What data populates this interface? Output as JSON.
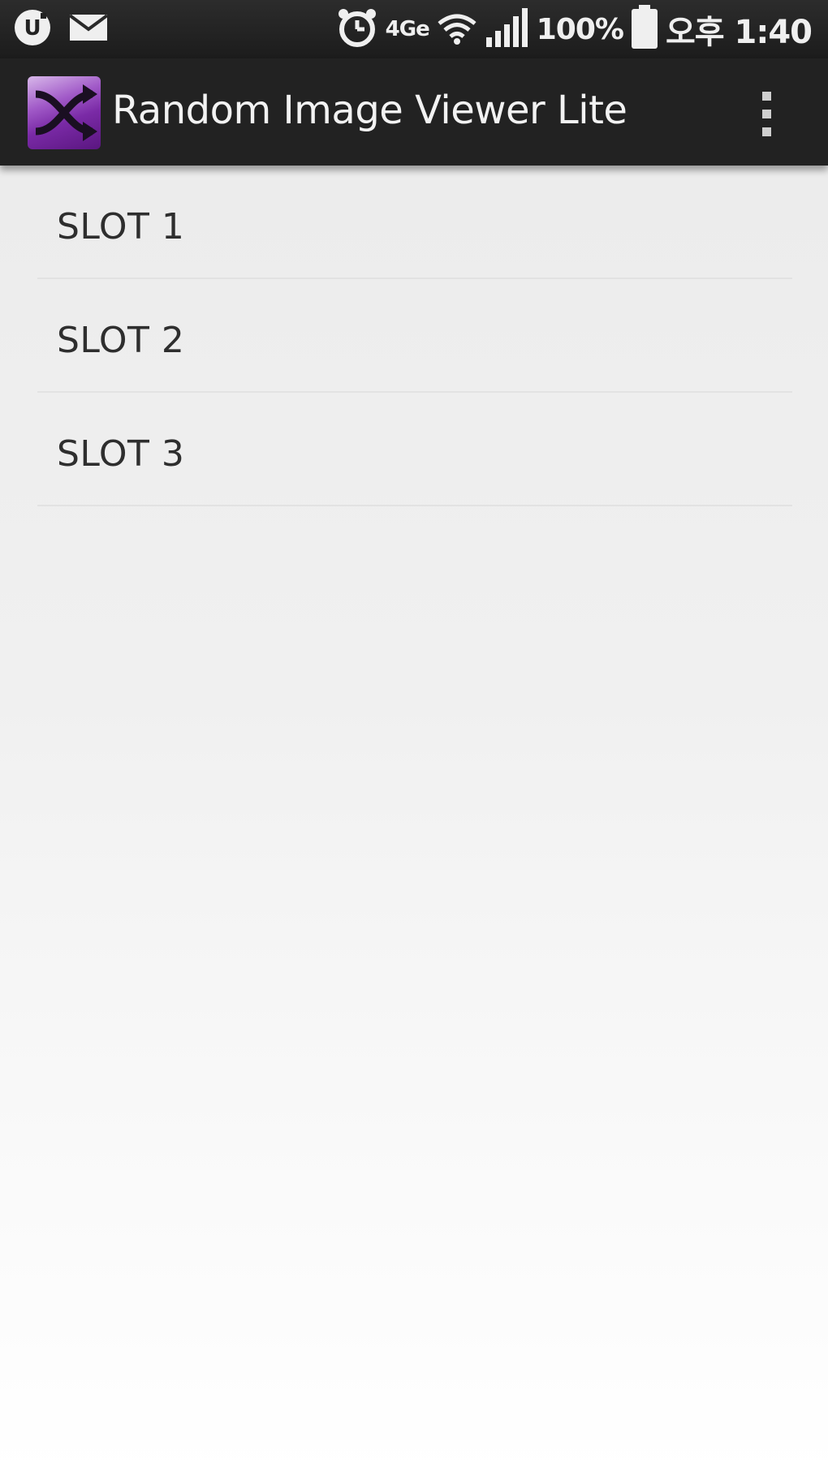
{
  "status_bar": {
    "left_icons": [
      "u-plus-icon",
      "mail-icon"
    ],
    "right_icons": [
      "alarm-icon",
      "network-type-icon",
      "wifi-icon",
      "signal-icon",
      "battery-icon"
    ],
    "network_label": "4Ge",
    "battery_level_text": "100%",
    "time_text": "오후 1:40"
  },
  "action_bar": {
    "title": "Random Image Viewer Lite",
    "app_icon": "shuffle-app-icon",
    "menu_icon": "overflow-menu-icon",
    "background_color": "#222222"
  },
  "slots": [
    {
      "label": "SLOT 1"
    },
    {
      "label": "SLOT 2"
    },
    {
      "label": "SLOT 3"
    }
  ]
}
